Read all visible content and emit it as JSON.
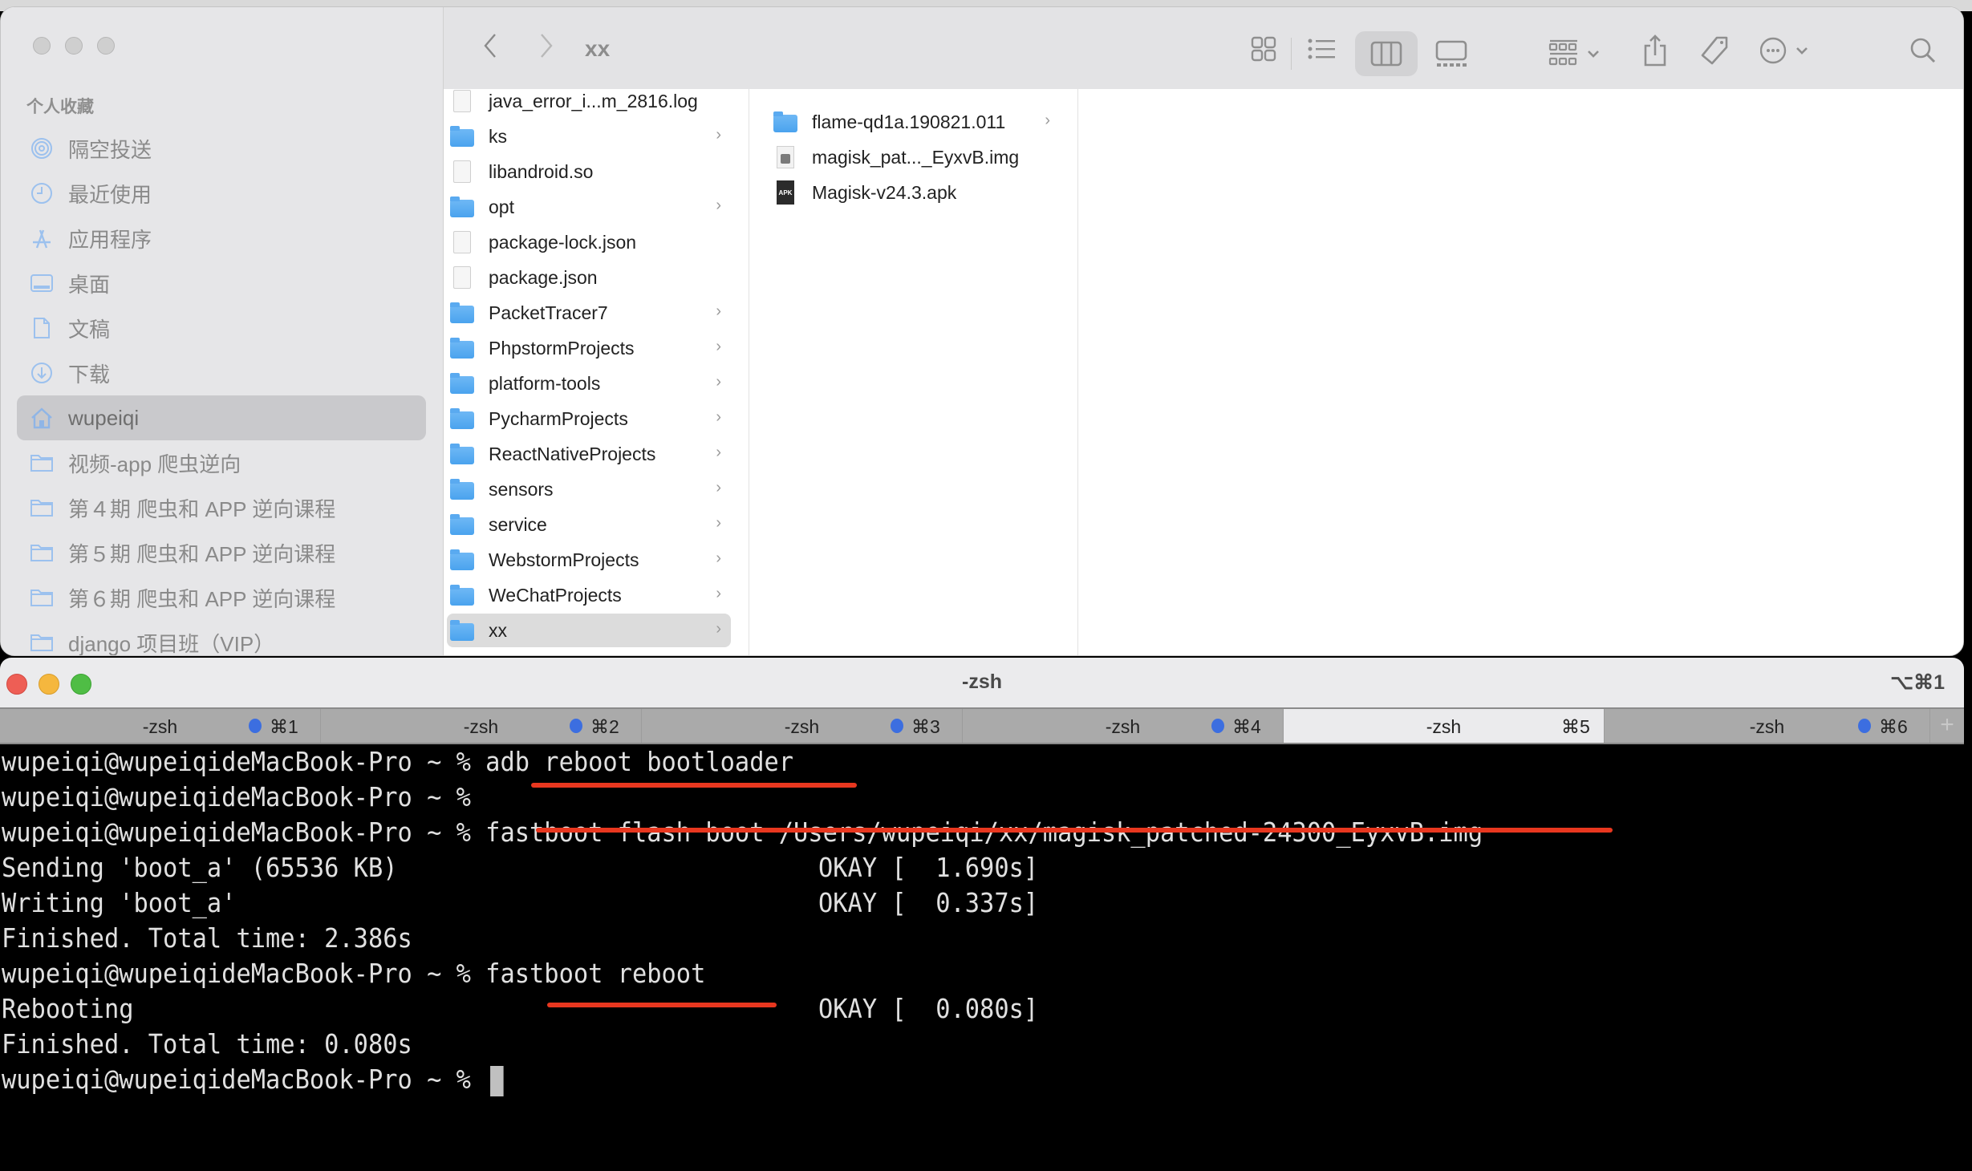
{
  "finder": {
    "window_title": "xx",
    "sidebar": {
      "section_header": "个人收藏",
      "items": [
        {
          "label": "隔空投送",
          "icon": "airdrop-icon"
        },
        {
          "label": "最近使用",
          "icon": "clock-icon"
        },
        {
          "label": "应用程序",
          "icon": "applications-icon"
        },
        {
          "label": "桌面",
          "icon": "desktop-icon"
        },
        {
          "label": "文稿",
          "icon": "document-icon"
        },
        {
          "label": "下载",
          "icon": "download-icon"
        },
        {
          "label": "wupeiqi",
          "icon": "home-icon",
          "selected": true
        },
        {
          "label": "视频-app 爬虫逆向",
          "icon": "folder-icon"
        },
        {
          "label": "第４期 爬虫和 APP 逆向课程",
          "icon": "folder-icon"
        },
        {
          "label": "第５期 爬虫和 APP 逆向课程",
          "icon": "folder-icon"
        },
        {
          "label": "第６期 爬虫和 APP 逆向课程",
          "icon": "folder-icon"
        },
        {
          "label": "django 项目班（VIP）",
          "icon": "folder-icon"
        }
      ]
    },
    "toolbar": {
      "back": "‹",
      "forward": "›",
      "views": [
        "icon-view",
        "list-view",
        "column-view",
        "gallery-view"
      ],
      "active_view": "column-view"
    },
    "column1": [
      {
        "name": "java_error_i...m_2816.log",
        "type": "log"
      },
      {
        "name": "ks",
        "type": "folder"
      },
      {
        "name": "libandroid.so",
        "type": "file"
      },
      {
        "name": "opt",
        "type": "folder"
      },
      {
        "name": "package-lock.json",
        "type": "file"
      },
      {
        "name": "package.json",
        "type": "file"
      },
      {
        "name": "PacketTracer7",
        "type": "folder"
      },
      {
        "name": "PhpstormProjects",
        "type": "folder"
      },
      {
        "name": "platform-tools",
        "type": "folder"
      },
      {
        "name": "PycharmProjects",
        "type": "folder"
      },
      {
        "name": "ReactNativeProjects",
        "type": "folder"
      },
      {
        "name": "sensors",
        "type": "folder"
      },
      {
        "name": "service",
        "type": "folder"
      },
      {
        "name": "WebstormProjects",
        "type": "folder"
      },
      {
        "name": "WeChatProjects",
        "type": "folder"
      },
      {
        "name": "xx",
        "type": "folder",
        "selected": true
      }
    ],
    "column2": [
      {
        "name": "flame-qd1a.190821.011",
        "type": "folder"
      },
      {
        "name": "magisk_pat..._EyxvB.img",
        "type": "img"
      },
      {
        "name": "Magisk-v24.3.apk",
        "type": "apk"
      }
    ]
  },
  "terminal": {
    "title": "-zsh",
    "window_shortcut": "⌥⌘1",
    "tabs": [
      {
        "label": "-zsh",
        "key": "⌘1",
        "dot": true
      },
      {
        "label": "-zsh",
        "key": "⌘2",
        "dot": true
      },
      {
        "label": "-zsh",
        "key": "⌘3",
        "dot": true
      },
      {
        "label": "-zsh",
        "key": "⌘4",
        "dot": true
      },
      {
        "label": "-zsh",
        "key": "⌘5",
        "dot": false,
        "active": true
      },
      {
        "label": "-zsh",
        "key": "⌘6",
        "dot": true
      }
    ],
    "add_tab": "+",
    "prompt": "wupeiqi@wupeiqideMacBook-Pro ~ % ",
    "lines": [
      {
        "text": "wupeiqi@wupeiqideMacBook-Pro ~ % adb reboot bootloader",
        "right": ""
      },
      {
        "text": "wupeiqi@wupeiqideMacBook-Pro ~ % ",
        "right": ""
      },
      {
        "text": "wupeiqi@wupeiqideMacBook-Pro ~ % fastboot flash boot /Users/wupeiqi/xx/magisk_patched-24300_EyxvB.img",
        "right": ""
      },
      {
        "text": "Sending 'boot_a' (65536 KB)",
        "right": "OKAY [  1.690s]"
      },
      {
        "text": "Writing 'boot_a'",
        "right": "OKAY [  0.337s]"
      },
      {
        "text": "Finished. Total time: 2.386s",
        "right": ""
      },
      {
        "text": "wupeiqi@wupeiqideMacBook-Pro ~ % fastboot reboot",
        "right": ""
      },
      {
        "text": "Rebooting",
        "right": "OKAY [  0.080s]"
      },
      {
        "text": "Finished. Total time: 0.080s",
        "right": ""
      },
      {
        "text": "wupeiqi@wupeiqideMacBook-Pro ~ % ",
        "right": ""
      }
    ],
    "annotation_color": "#e8371f"
  }
}
